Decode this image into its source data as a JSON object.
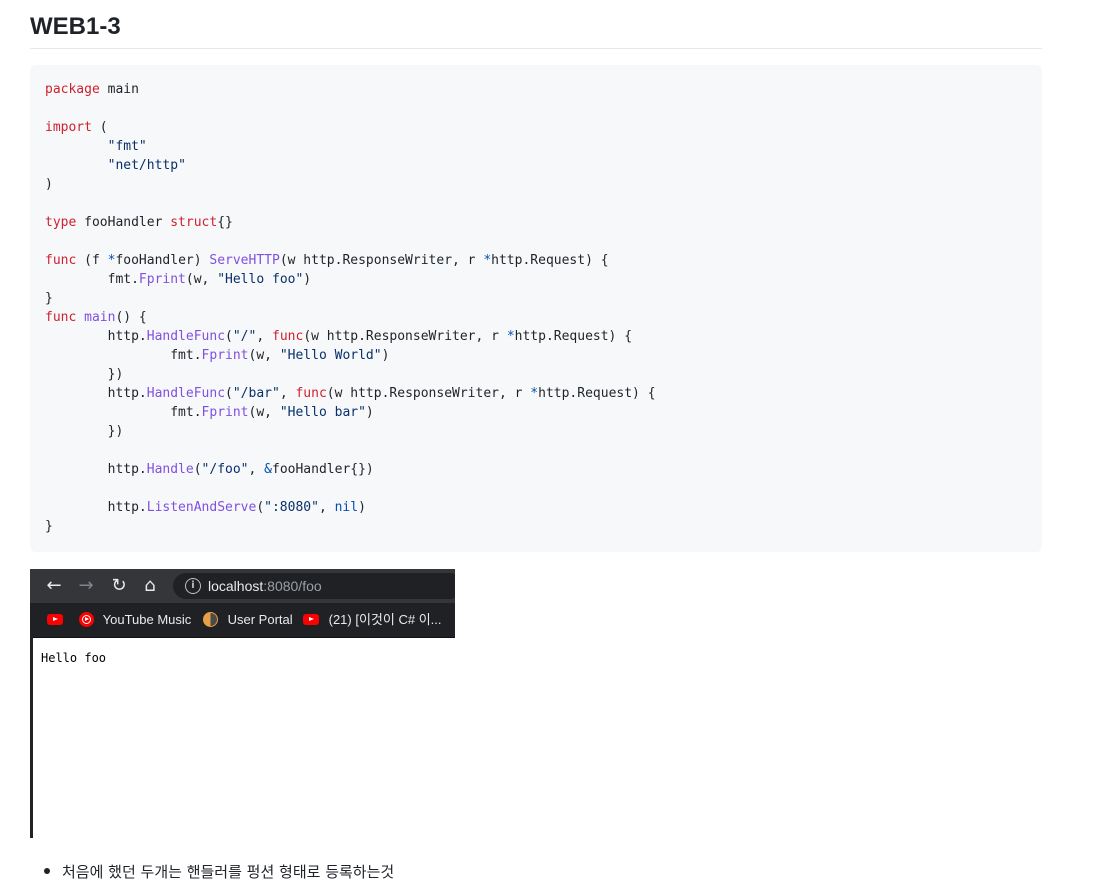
{
  "heading": {
    "title": "WEB1-3"
  },
  "code_lines": [
    [
      [
        "kw",
        "package"
      ],
      [
        "plain",
        " main"
      ]
    ],
    [],
    [
      [
        "kw",
        "import"
      ],
      [
        "plain",
        " ("
      ]
    ],
    [
      [
        "plain",
        "        "
      ],
      [
        "str",
        "\"fmt\""
      ]
    ],
    [
      [
        "plain",
        "        "
      ],
      [
        "str",
        "\"net/http\""
      ]
    ],
    [
      [
        "plain",
        ")"
      ]
    ],
    [],
    [
      [
        "kw",
        "type"
      ],
      [
        "plain",
        " fooHandler "
      ],
      [
        "kw",
        "struct"
      ],
      [
        "plain",
        "{}"
      ]
    ],
    [],
    [
      [
        "kw",
        "func"
      ],
      [
        "plain",
        " (f "
      ],
      [
        "op",
        "*"
      ],
      [
        "plain",
        "fooHandler) "
      ],
      [
        "fn",
        "ServeHTTP"
      ],
      [
        "plain",
        "(w http.ResponseWriter, r "
      ],
      [
        "op",
        "*"
      ],
      [
        "plain",
        "http.Request) {"
      ]
    ],
    [
      [
        "plain",
        "        fmt."
      ],
      [
        "fn",
        "Fprint"
      ],
      [
        "plain",
        "(w, "
      ],
      [
        "str",
        "\"Hello foo\""
      ],
      [
        "plain",
        ")"
      ]
    ],
    [
      [
        "plain",
        "}"
      ]
    ],
    [
      [
        "kw",
        "func"
      ],
      [
        "plain",
        " "
      ],
      [
        "fn",
        "main"
      ],
      [
        "plain",
        "() {"
      ]
    ],
    [
      [
        "plain",
        "        http."
      ],
      [
        "fn",
        "HandleFunc"
      ],
      [
        "plain",
        "("
      ],
      [
        "str",
        "\"/\""
      ],
      [
        "plain",
        ", "
      ],
      [
        "kw",
        "func"
      ],
      [
        "plain",
        "(w http.ResponseWriter, r "
      ],
      [
        "op",
        "*"
      ],
      [
        "plain",
        "http.Request) {"
      ]
    ],
    [
      [
        "plain",
        "                fmt."
      ],
      [
        "fn",
        "Fprint"
      ],
      [
        "plain",
        "(w, "
      ],
      [
        "str",
        "\"Hello World\""
      ],
      [
        "plain",
        ")"
      ]
    ],
    [
      [
        "plain",
        "        })"
      ]
    ],
    [
      [
        "plain",
        "        http."
      ],
      [
        "fn",
        "HandleFunc"
      ],
      [
        "plain",
        "("
      ],
      [
        "str",
        "\"/bar\""
      ],
      [
        "plain",
        ", "
      ],
      [
        "kw",
        "func"
      ],
      [
        "plain",
        "(w http.ResponseWriter, r "
      ],
      [
        "op",
        "*"
      ],
      [
        "plain",
        "http.Request) {"
      ]
    ],
    [
      [
        "plain",
        "                fmt."
      ],
      [
        "fn",
        "Fprint"
      ],
      [
        "plain",
        "(w, "
      ],
      [
        "str",
        "\"Hello bar\""
      ],
      [
        "plain",
        ")"
      ]
    ],
    [
      [
        "plain",
        "        })"
      ]
    ],
    [],
    [
      [
        "plain",
        "        http."
      ],
      [
        "fn",
        "Handle"
      ],
      [
        "plain",
        "("
      ],
      [
        "str",
        "\"/foo\""
      ],
      [
        "plain",
        ", "
      ],
      [
        "op",
        "&"
      ],
      [
        "plain",
        "fooHandler{})"
      ]
    ],
    [],
    [
      [
        "plain",
        "        http."
      ],
      [
        "fn",
        "ListenAndServe"
      ],
      [
        "plain",
        "("
      ],
      [
        "str",
        "\":8080\""
      ],
      [
        "plain",
        ", "
      ],
      [
        "op",
        "nil"
      ],
      [
        "plain",
        ")"
      ]
    ],
    [
      [
        "plain",
        "}"
      ]
    ]
  ],
  "browser": {
    "back_icon": "←",
    "forward_icon": "→",
    "reload_icon": "↻",
    "home_icon": "⌂",
    "info_icon": "i",
    "url_host": "localhost",
    "url_rest": ":8080/foo",
    "bookmarks": [
      {
        "icon": "youtube-icon",
        "label": ""
      },
      {
        "icon": "youtube-music-icon",
        "label": "YouTube Music"
      },
      {
        "icon": "user-portal-icon",
        "label": "User Portal"
      },
      {
        "icon": "youtube-icon",
        "label": "(21) [이것이 C# 이..."
      }
    ],
    "page_text": "Hello foo"
  },
  "notes": [
    "처음에 했던 두개는 핸들러를 펑션 형태로 등록하는것"
  ],
  "colors": {
    "keyword": "#cf222e",
    "function": "#8250df",
    "string": "#0a3069",
    "operator": "#0550ae",
    "code_bg": "#f6f8fa"
  }
}
